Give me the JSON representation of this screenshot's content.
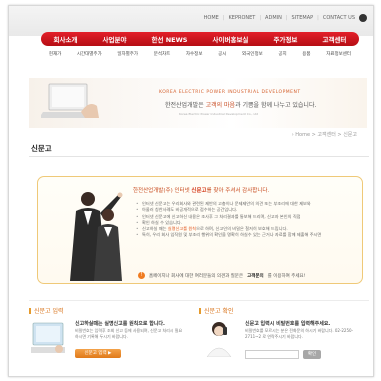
{
  "top_links": [
    "HOME",
    "KEPRONET",
    "ADMIN",
    "SITEMAP",
    "CONTACT US"
  ],
  "main_nav": [
    "회사소개",
    "사업분야",
    "한선 NEWS",
    "사이버홍보실",
    "주가정보",
    "고객센터"
  ],
  "sub_nav": [
    "현재가",
    "시간대별주가",
    "일자별주가",
    "분석차트",
    "자수정보",
    "공시",
    "외국인정보",
    "공지",
    "용품",
    "자료정보센터"
  ],
  "hero": {
    "english": "KOREA ELECTRIC POWER INDUSTRIAL DEVELOPMENT",
    "korean_prefix": "한전산업개발은",
    "korean_highlight": "고객의 마음",
    "korean_suffix": "과 기쁨을 함께 나누고 있습니다.",
    "small": "Korea Electric Power Industrial Development Co., Ltd"
  },
  "breadcrumb": "› Home > 고객센터 > 신문고",
  "page_title": "신문고",
  "infobox": {
    "greeting_prefix": "한전산업개발(주) 인터넷",
    "greeting_highlight": "신문고",
    "greeting_suffix": "를 찾아 주셔서 감사합니다.",
    "bullets": [
      {
        "text": "인터넷 신문고는 우리회사와 관련된 제반의 고충이나 문제제안의 의견 또는 부조리에 대한 제보와",
        "hl": ""
      },
      {
        "text": "아울러 칭찬사례도 비공개적으로 접수하는 공간입니다.",
        "hl": ""
      },
      {
        "text": "인터넷 신문고에 신고하신 내용은 조사후 그 처리결과를 통보해 드리며, 신고자 본인의 직접",
        "hl": ""
      },
      {
        "text": "확인 하실 수 있습니다.",
        "hl": ""
      },
      {
        "text": "신고하실 때는",
        "hl": "실명신고를 원칙",
        "tail": "으로 하며, 신고인의 비밀은 철저히 보호해 드립니다."
      },
      {
        "text": "특히, 우리 회사 임직원 및 부조리 행위의 확인을 명확히 하실수 있는 근거나 자료를 함께 제출해 주시면",
        "hl": ""
      }
    ],
    "notice_prefix": "홈페이지나 회사에 대한 여러분들의 의견과 질문은",
    "notice_bold": "고객문의",
    "notice_suffix": "를 이용하여 주세요!"
  },
  "section_left": {
    "title": "신문고 입력",
    "heading": "신고하실때는 실명신고를 원칙으로 합니다.",
    "text": "비밀번호는 입력후 조회 신고 등에 사용되며, 신문고 처리시 필요하시면 기록해 두시기 바랍니다.",
    "button": "신문고 입력 ▶"
  },
  "section_right": {
    "title": "신문고 확인",
    "heading": "신문고 입력시 비밀번호를 입력해주세요.",
    "text": "비밀번호를 모르시는 분은 전화문의 하시기 바랍니다. 02-2250-2711~2 로 연락주시기 바랍니다.",
    "button": "확인"
  }
}
